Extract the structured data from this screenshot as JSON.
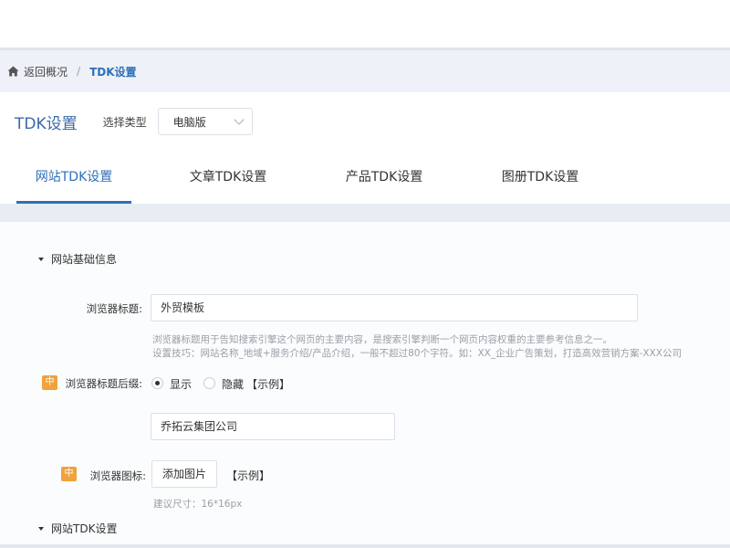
{
  "breadcrumb": {
    "back_label": "返回概况",
    "separator": "/",
    "current": "TDK设置"
  },
  "header": {
    "title": "TDK设置",
    "type_label": "选择类型",
    "type_value": "电脑版"
  },
  "tabs": [
    {
      "label": "网站TDK设置",
      "active": true
    },
    {
      "label": "文章TDK设置",
      "active": false
    },
    {
      "label": "产品TDK设置",
      "active": false
    },
    {
      "label": "图册TDK设置",
      "active": false
    }
  ],
  "sections": {
    "basic": "网站基础信息",
    "site_tdk": "网站TDK设置"
  },
  "form": {
    "browser_title": {
      "label": "浏览器标题:",
      "value": "外贸模板",
      "help1": "浏览器标题用于告知搜索引擎这个网页的主要内容，是搜索引擎判断一个网页内容权重的主要参考信息之一。",
      "help2": "设置技巧：网站名称_地域+服务介绍/产品介绍，一般不超过80个字符。如：XX_企业广告策划，打造高效营销方案-XXX公司"
    },
    "title_suffix": {
      "badge": "中",
      "label": "浏览器标题后缀:",
      "options": [
        "显示",
        "隐藏"
      ],
      "selected": "显示",
      "example": "【示例】",
      "value": "乔拓云集团公司"
    },
    "favicon": {
      "badge": "中",
      "label": "浏览器图标:",
      "button": "添加图片",
      "example": "【示例】",
      "hint": "建议尺寸：16*16px"
    }
  },
  "colors": {
    "accent": "#2f6fb6",
    "badge": "#f0a23c"
  },
  "icons": {
    "home": "home-icon",
    "select": "chevron-down-icon",
    "collapse": "caret-down-icon"
  }
}
